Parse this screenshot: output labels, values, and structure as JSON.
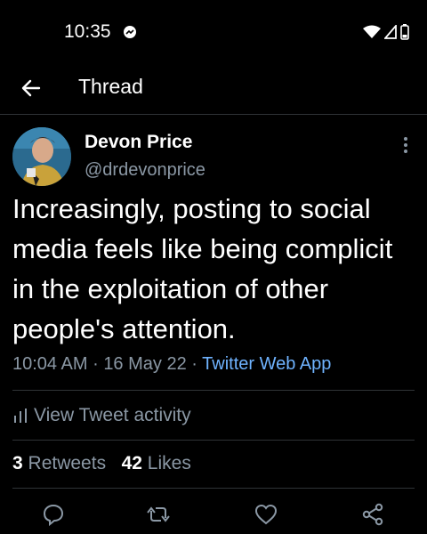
{
  "status_bar": {
    "time": "10:35"
  },
  "header": {
    "title": "Thread"
  },
  "tweet": {
    "display_name": "Devon Price",
    "handle": "@drdevonprice",
    "text": "Increasingly, posting to social media feels like being complicit in the exploitation of other people's attention.",
    "time": "10:04 AM",
    "date": "16 May 22",
    "source": "Twitter Web App",
    "activity_label": "View Tweet activity",
    "retweets_count": "3",
    "retweets_label": "Retweets",
    "likes_count": "42",
    "likes_label": "Likes"
  },
  "icons": {
    "back": "arrow-left-icon",
    "more": "more-vertical-icon",
    "reply": "reply-icon",
    "retweet": "retweet-icon",
    "like": "like-icon",
    "share": "share-icon"
  },
  "colors": {
    "background": "#000000",
    "text": "#e7e9ea",
    "muted": "#8b98a5",
    "link": "#6fb3ff"
  }
}
